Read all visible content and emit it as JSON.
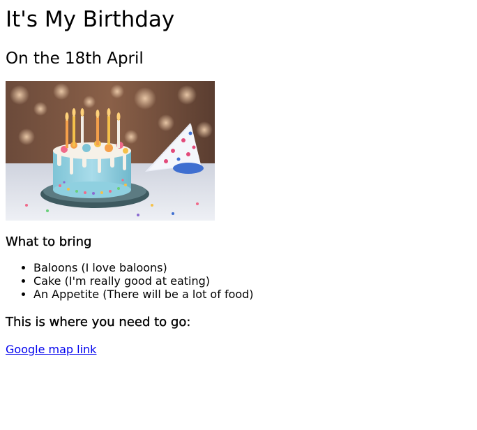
{
  "heading": {
    "title": "It's My Birthday",
    "subtitle": "On the 18th April"
  },
  "bring": {
    "heading": "What to bring",
    "items": [
      "Baloons (I love baloons)",
      "Cake (I'm really good at eating)",
      "An Appetite (There will be a lot of food)"
    ]
  },
  "directions": {
    "heading": "This is where you need to go:",
    "link_label": "Google map link"
  },
  "colors": {
    "link": "#0000ee",
    "text": "#000000",
    "background": "#ffffff"
  }
}
